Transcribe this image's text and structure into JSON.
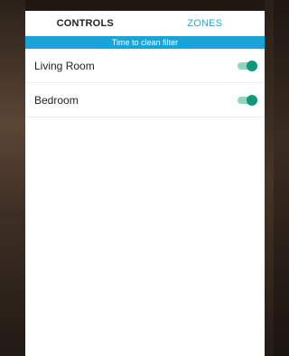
{
  "tabs": [
    {
      "label": "CONTROLS",
      "active": true
    },
    {
      "label": "ZONES",
      "active": false
    }
  ],
  "banner": {
    "text": "Time to clean filter"
  },
  "zones": [
    {
      "name": "Living Room",
      "enabled": true
    },
    {
      "name": "Bedroom",
      "enabled": true
    }
  ],
  "colors": {
    "accent": "#1aa3d5",
    "toggle_on": "#11967a",
    "toggle_track": "#8fd6c0"
  }
}
